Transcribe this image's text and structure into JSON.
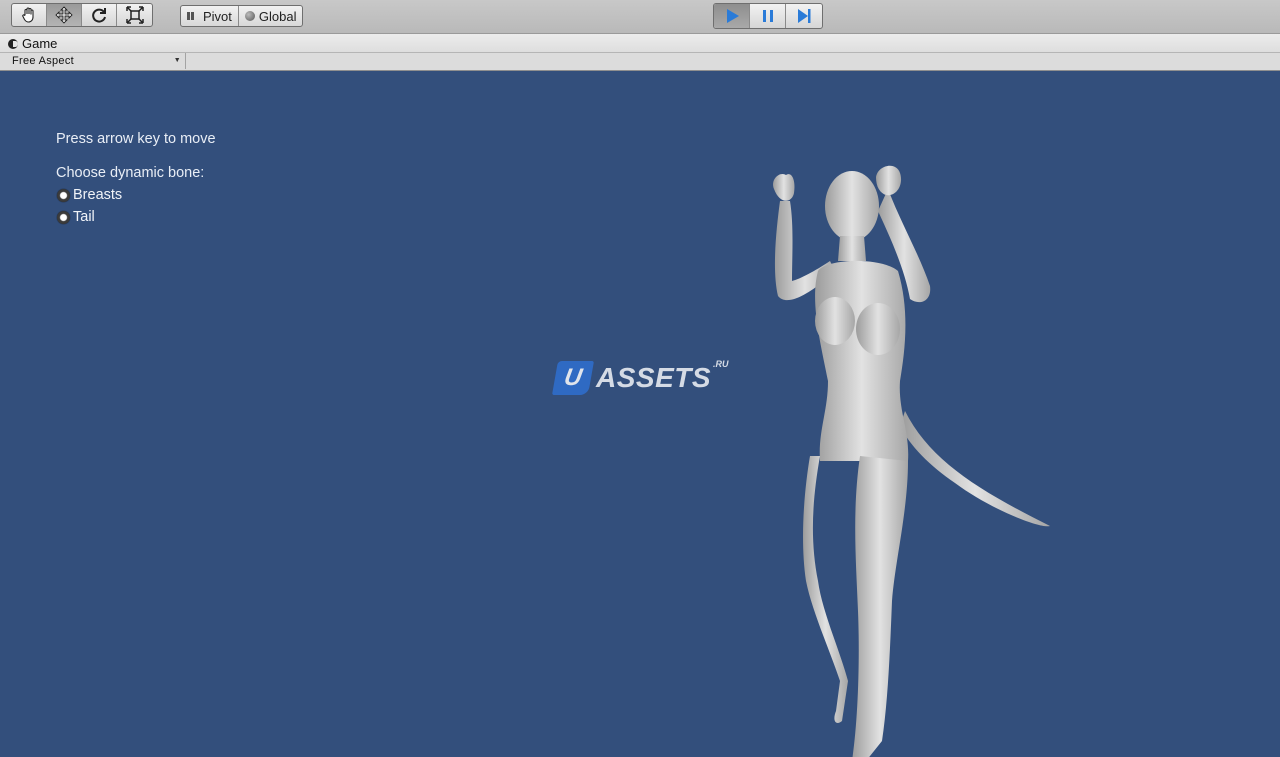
{
  "toolbar": {
    "transform_tools": [
      "hand-icon",
      "move-icon",
      "rotate-icon",
      "scale-icon"
    ],
    "active_tool": "move-icon",
    "pivot_label": "Pivot",
    "global_label": "Global",
    "playback": [
      "play-icon",
      "pause-icon",
      "step-icon"
    ],
    "accent": "#2a7bd8"
  },
  "tab": {
    "label": "Game"
  },
  "aspect": {
    "selected": "Free Aspect"
  },
  "game": {
    "hint": "Press arrow key to move",
    "choose_label": "Choose dynamic bone:",
    "options": [
      "Breasts",
      "Tail"
    ],
    "background": "#334f7c"
  },
  "watermark": {
    "u": "U",
    "text": "ASSETS",
    "suffix": ".RU"
  }
}
